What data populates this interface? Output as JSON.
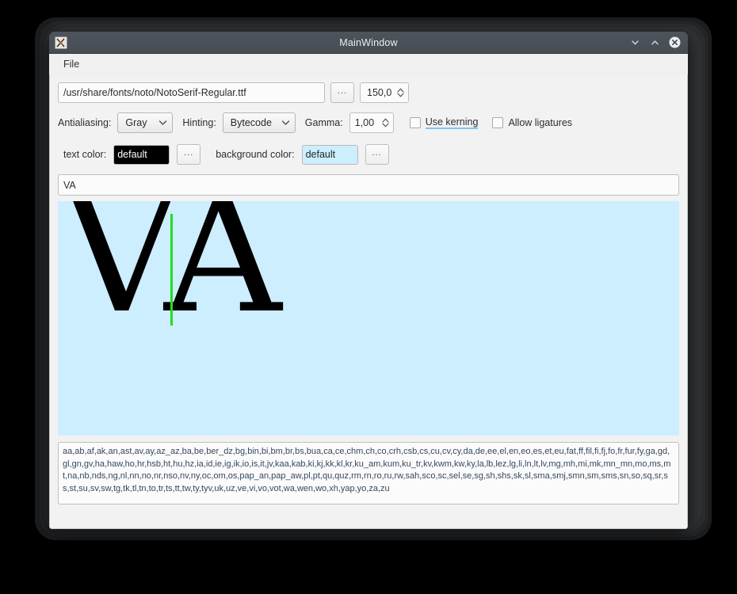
{
  "window": {
    "title": "MainWindow",
    "icon": "app-icon",
    "controls": {
      "minimize": "minimize-icon",
      "maximize": "maximize-icon",
      "close": "close-icon"
    }
  },
  "menubar": {
    "items": [
      {
        "label": "File"
      }
    ]
  },
  "file_row": {
    "font_path": "/usr/share/fonts/noto/NotoSerif-Regular.ttf",
    "browse_label": "...",
    "font_size": "150,0"
  },
  "options_row": {
    "antialiasing_label": "Antialiasing:",
    "antialiasing_value": "Gray",
    "hinting_label": "Hinting:",
    "hinting_value": "Bytecode",
    "gamma_label": "Gamma:",
    "gamma_value": "1,00",
    "use_kerning_label": "Use kerning",
    "use_kerning_checked": false,
    "allow_ligatures_label": "Allow ligatures",
    "allow_ligatures_checked": false
  },
  "color_row": {
    "text_color_label": "text color:",
    "text_color_value": "default",
    "text_color_swatch": "#000000",
    "text_color_browse": "...",
    "background_color_label": "background color:",
    "background_color_value": "default",
    "background_color_swatch": "#cdeefd",
    "background_color_browse": "..."
  },
  "preview": {
    "input_value": "VA",
    "rendered_text": "VA",
    "canvas_background": "#cceeff",
    "glyph_color": "#000000",
    "cursor_color": "#22dd22"
  },
  "languages": {
    "text": "aa,ab,af,ak,an,ast,av,ay,az_az,ba,be,ber_dz,bg,bin,bi,bm,br,bs,bua,ca,ce,chm,ch,co,crh,csb,cs,cu,cv,cy,da,de,ee,el,en,eo,es,et,eu,fat,ff,fil,fi,fj,fo,fr,fur,fy,ga,gd,gl,gn,gv,ha,haw,ho,hr,hsb,ht,hu,hz,ia,id,ie,ig,ik,io,is,it,jv,kaa,kab,ki,kj,kk,kl,kr,ku_am,kum,ku_tr,kv,kwm,kw,ky,la,lb,lez,lg,li,ln,lt,lv,mg,mh,mi,mk,mn_mn,mo,ms,mt,na,nb,nds,ng,nl,nn,no,nr,nso,nv,ny,oc,om,os,pap_an,pap_aw,pl,pt,qu,quz,rm,rn,ro,ru,rw,sah,sco,sc,sel,se,sg,sh,shs,sk,sl,sma,smj,smn,sm,sms,sn,so,sq,sr,ss,st,su,sv,sw,tg,tk,tl,tn,to,tr,ts,tt,tw,ty,tyv,uk,uz,ve,vi,vo,vot,wa,wen,wo,xh,yap,yo,za,zu"
  }
}
